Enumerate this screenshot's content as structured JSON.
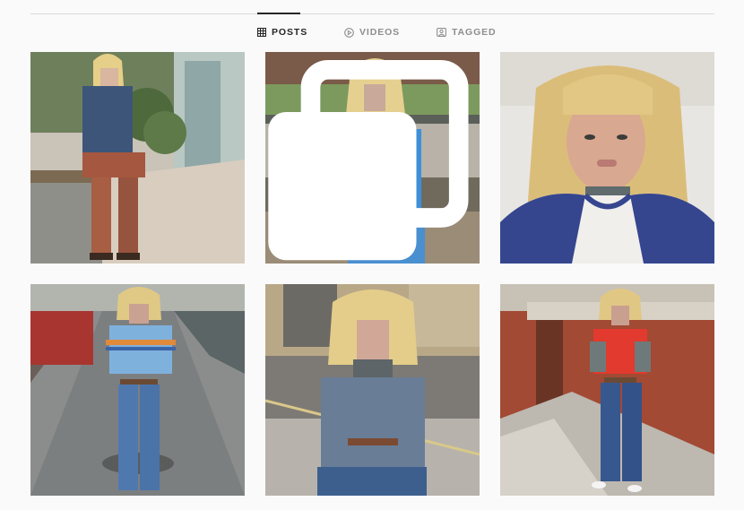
{
  "tabs": [
    {
      "label": "POSTS",
      "icon": "grid-icon",
      "active": true
    },
    {
      "label": "VIDEOS",
      "icon": "play-icon",
      "active": false
    },
    {
      "label": "TAGGED",
      "icon": "tag-icon",
      "active": false
    }
  ],
  "colors": {
    "background": "#fafafa",
    "divider": "#dbdbdb",
    "active_tab": "#262626",
    "inactive_tab": "#8e8e8e"
  },
  "posts": [
    {
      "id": "post-1",
      "icon": "photo-icon"
    },
    {
      "id": "post-2",
      "icon": "photo-icon",
      "multi": true
    },
    {
      "id": "post-3",
      "icon": "photo-icon"
    },
    {
      "id": "post-4",
      "icon": "photo-icon"
    },
    {
      "id": "post-5",
      "icon": "photo-icon"
    },
    {
      "id": "post-6",
      "icon": "photo-icon"
    }
  ]
}
